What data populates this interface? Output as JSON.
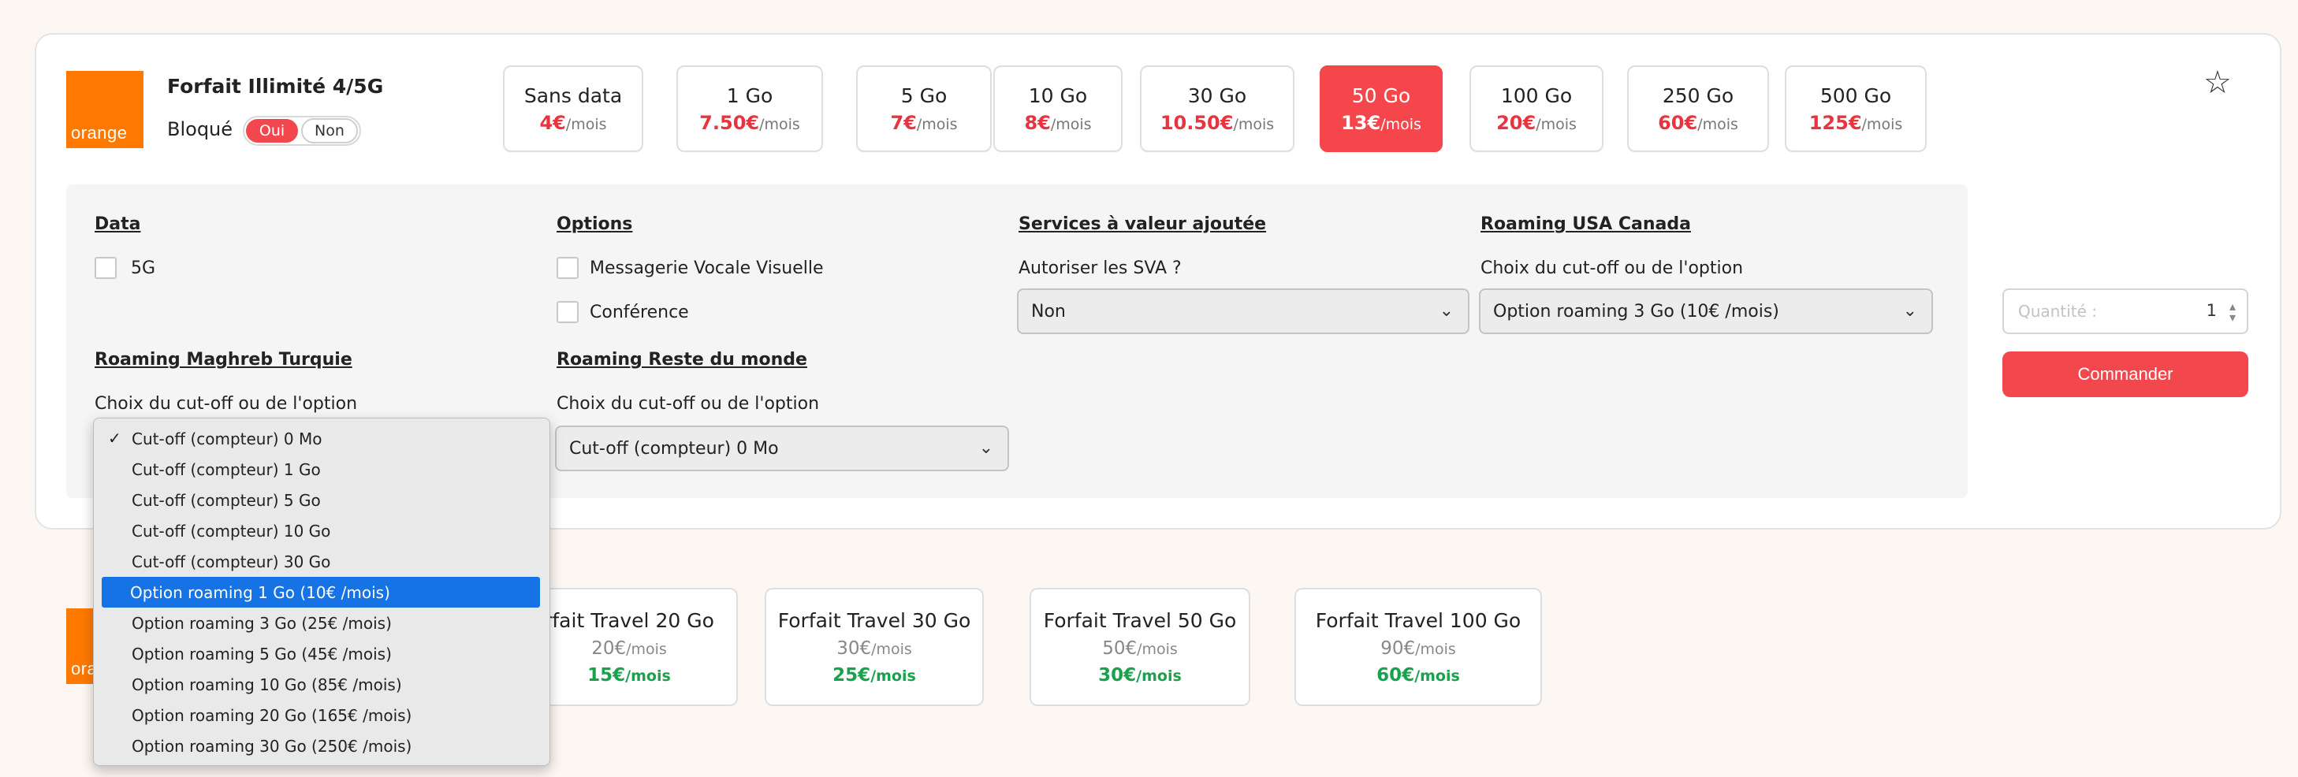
{
  "plan": {
    "brand": "orange",
    "title": "Forfait Illimité 4/5G",
    "bloque_label": "Bloqué",
    "toggle_on": "Oui",
    "toggle_off": "Non"
  },
  "data_options": [
    {
      "name": "Sans data",
      "price": "4€",
      "unit": "/mois",
      "selected": false
    },
    {
      "name": "1 Go",
      "price": "7.50€",
      "unit": "/mois",
      "selected": false
    },
    {
      "name": "5 Go",
      "price": "7€",
      "unit": "/mois",
      "selected": false
    },
    {
      "name": "10 Go",
      "price": "8€",
      "unit": "/mois",
      "selected": false
    },
    {
      "name": "30 Go",
      "price": "10.50€",
      "unit": "/mois",
      "selected": false
    },
    {
      "name": "50 Go",
      "price": "13€",
      "unit": "/mois",
      "selected": true
    },
    {
      "name": "100 Go",
      "price": "20€",
      "unit": "/mois",
      "selected": false
    },
    {
      "name": "250 Go",
      "price": "60€",
      "unit": "/mois",
      "selected": false
    },
    {
      "name": "500 Go",
      "price": "125€",
      "unit": "/mois",
      "selected": false
    }
  ],
  "sections": {
    "data": {
      "title": "Data",
      "checkbox_5g": "5G"
    },
    "options": {
      "title": "Options",
      "visual_voicemail": "Messagerie Vocale Visuelle",
      "conference": "Conférence"
    },
    "sva": {
      "title": "Services à valeur ajoutée",
      "question": "Autoriser les SVA ?",
      "value": "Non"
    },
    "usa_canada": {
      "title": "Roaming USA Canada",
      "label": "Choix du cut-off ou de l'option",
      "value": "Option roaming 3 Go (10€ /mois)"
    },
    "maghreb": {
      "title": "Roaming Maghreb Turquie",
      "label": "Choix du cut-off ou de l'option"
    },
    "world": {
      "title": "Roaming Reste du monde",
      "label": "Choix du cut-off ou de l'option",
      "value": "Cut-off (compteur) 0 Mo"
    }
  },
  "quantity": {
    "placeholder": "Quantité :",
    "value": "1"
  },
  "order_button": "Commander",
  "dropdown_options": [
    {
      "label": "Cut-off (compteur) 0 Mo",
      "checked": true
    },
    {
      "label": "Cut-off (compteur) 1 Go"
    },
    {
      "label": "Cut-off (compteur) 5 Go"
    },
    {
      "label": "Cut-off (compteur) 10 Go"
    },
    {
      "label": "Cut-off (compteur) 30 Go"
    },
    {
      "label": "Option roaming 1 Go (10€ /mois)",
      "highlighted": true
    },
    {
      "label": "Option roaming 3 Go (25€ /mois)"
    },
    {
      "label": "Option roaming 5 Go (45€ /mois)"
    },
    {
      "label": "Option roaming 10 Go (85€ /mois)"
    },
    {
      "label": "Option roaming 20 Go (165€ /mois)"
    },
    {
      "label": "Option roaming 30 Go (250€ /mois)"
    }
  ],
  "check_mark": "✓",
  "travel_brand_partial": "ora",
  "travel_plans": [
    {
      "name": "rfait Travel 20 Go",
      "old_price": "20€",
      "new_price": "15€",
      "unit": "/mois"
    },
    {
      "name": "Forfait Travel 30 Go",
      "old_price": "30€",
      "new_price": "25€",
      "unit": "/mois"
    },
    {
      "name": "Forfait Travel 50 Go",
      "old_price": "50€",
      "new_price": "30€",
      "unit": "/mois"
    },
    {
      "name": "Forfait Travel 100 Go",
      "old_price": "90€",
      "new_price": "60€",
      "unit": "/mois"
    }
  ],
  "icons": {
    "favorite": "star-outline-icon",
    "select_chevron": "chevron-down-icon",
    "spinner": "spin-arrows-icon"
  },
  "colors": {
    "brand_orange": "#ff7900",
    "accent_red": "#f1474d",
    "promo_green": "#1aa14e",
    "highlight_blue": "#1673e6"
  }
}
